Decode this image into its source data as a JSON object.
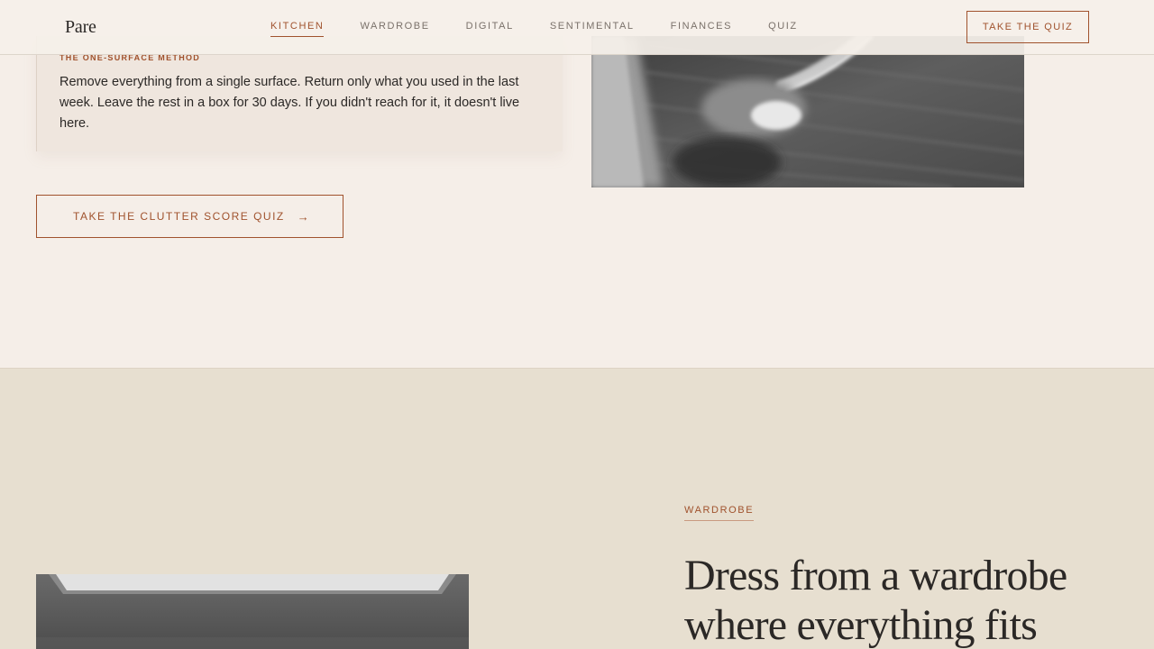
{
  "nav": {
    "logo": "Pare",
    "links": [
      {
        "label": "KITCHEN",
        "active": true
      },
      {
        "label": "WARDROBE"
      },
      {
        "label": "DIGITAL"
      },
      {
        "label": "SENTIMENTAL"
      },
      {
        "label": "FINANCES"
      },
      {
        "label": "QUIZ"
      }
    ],
    "cta_label": "TAKE THE QUIZ"
  },
  "kitchen": {
    "method_label": "THE ONE-SURFACE METHOD",
    "method_body": "Remove everything from a single surface. Return only what you used in the last week. Leave the rest in a box for 30 days. If you didn't reach for it, it doesn't live here.",
    "quiz_button_label": "TAKE THE CLUTTER SCORE QUIZ",
    "quiz_button_icon": "arrow-right-icon"
  },
  "wardrobe": {
    "tag": "WARDROBE",
    "heading": "Dress from a wardrobe where everything fits"
  },
  "colors": {
    "accent": "#a0522d",
    "page_background": "#f5eee8",
    "section_background": "#e7dfd0",
    "text": "#2b2826"
  }
}
